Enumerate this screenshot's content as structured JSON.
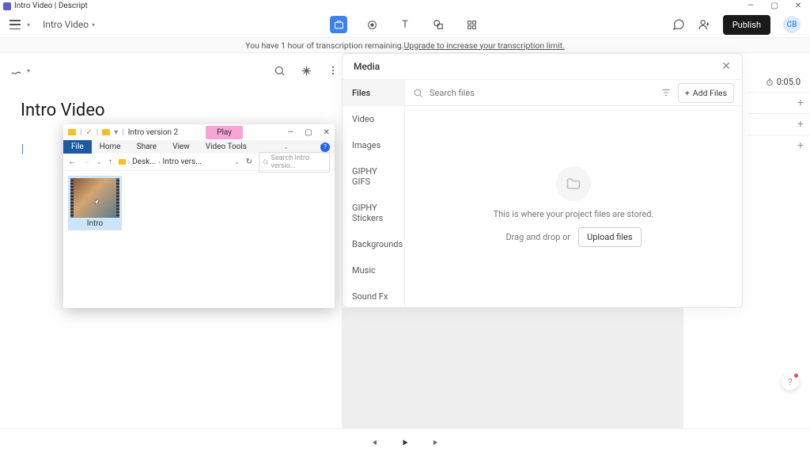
{
  "window": {
    "title": "Intro Video | Descript"
  },
  "toolbar": {
    "project_name": "Intro Video",
    "publish_label": "Publish",
    "avatar_initials": "CB"
  },
  "banner": {
    "text": "You have 1 hour of transcription remaining. ",
    "link": "Upgrade to increase your transcription limit."
  },
  "script": {
    "title": "Intro Video"
  },
  "timeline": {
    "time_display": "0:05.0"
  },
  "media": {
    "title": "Media",
    "close": "✕",
    "search_placeholder": "Search files",
    "add_files_label": "Add Files",
    "categories": [
      "Files",
      "Video",
      "Images",
      "GIPHY GIFS",
      "GIPHY Stickers",
      "Backgrounds",
      "Music",
      "Sound Fx"
    ],
    "empty_msg": "This is where your project files are stored.",
    "drag_msg": "Drag and drop or",
    "upload_label": "Upload files"
  },
  "explorer": {
    "folder": "Intro version 2",
    "play": "Play",
    "menu": [
      "File",
      "Home",
      "Share",
      "View",
      "Video Tools"
    ],
    "crumb1": "Desk...",
    "crumb2": "Intro vers...",
    "search_placeholder": "Search Intro versio...",
    "file_name": "Intro"
  },
  "playbar": {}
}
